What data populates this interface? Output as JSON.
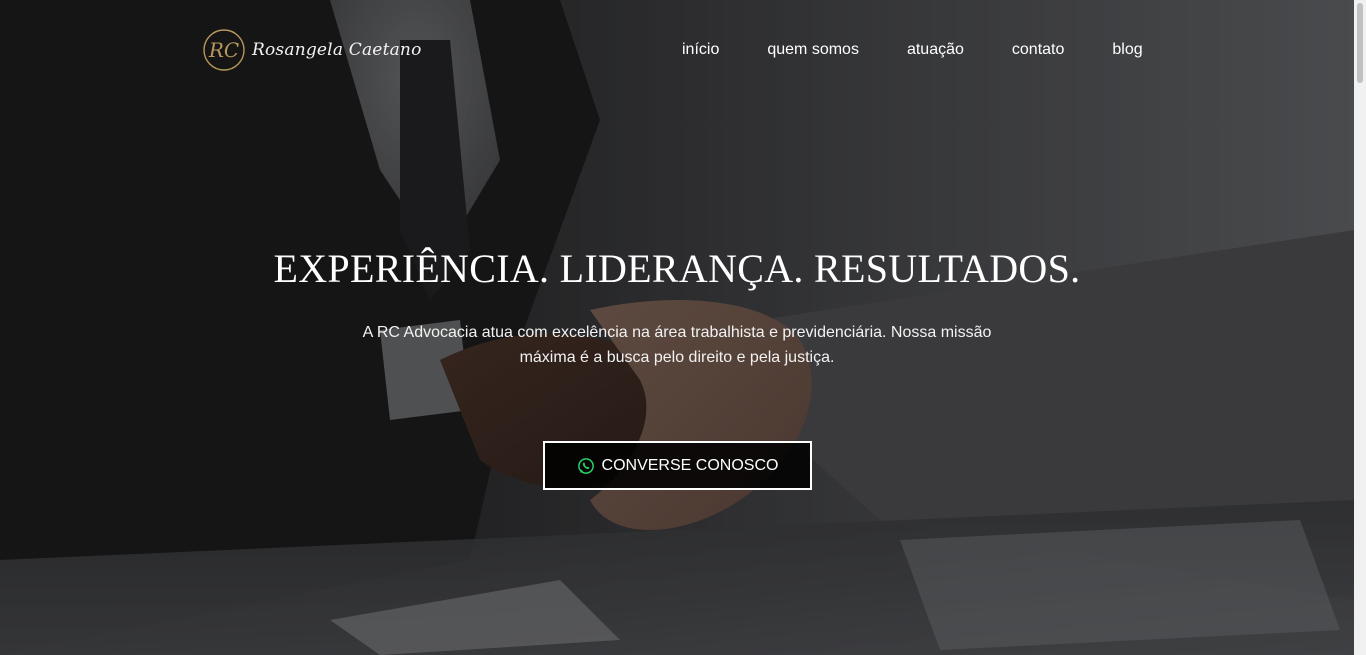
{
  "brand": {
    "name": "Rosangela Caetano",
    "monogram": "RC",
    "accent_color": "#b8975a"
  },
  "nav": {
    "items": [
      {
        "label": "início"
      },
      {
        "label": "quem somos"
      },
      {
        "label": "atuação"
      },
      {
        "label": "contato"
      },
      {
        "label": "blog"
      }
    ]
  },
  "hero": {
    "title": "EXPERIÊNCIA. LIDERANÇA. RESULTADOS.",
    "description": "A RC Advocacia atua com excelência na área trabalhista e previdenciária. Nossa missão máxima é a busca pelo direito e pela justiça.",
    "cta_label": "CONVERSE CONOSCO",
    "cta_icon": "whatsapp-icon",
    "whatsapp_color": "#25d366"
  }
}
